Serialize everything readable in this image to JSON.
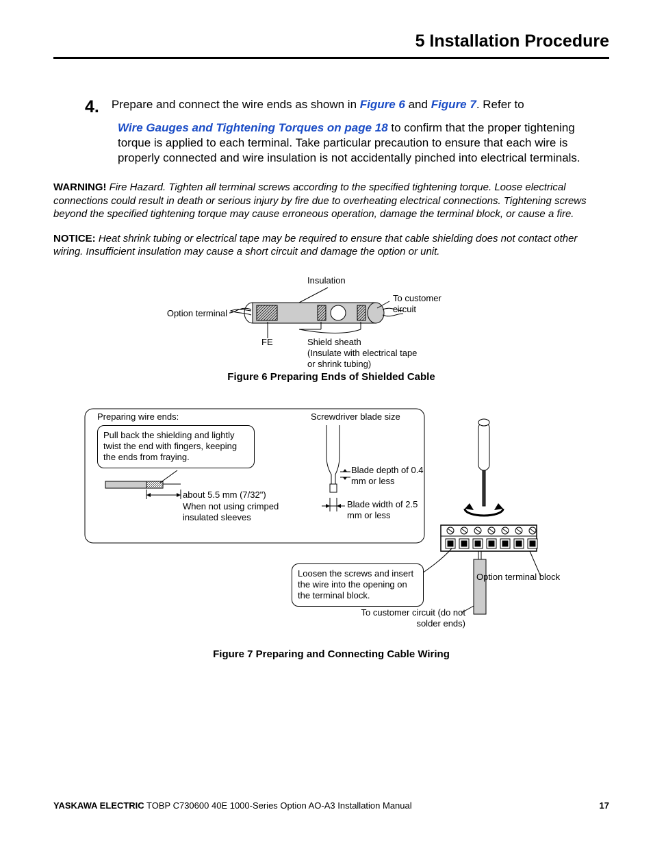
{
  "header": {
    "section": "5  Installation Procedure"
  },
  "step": {
    "number": "4.",
    "text_a": "Prepare and connect the wire ends as shown in ",
    "link_fig6": "Figure 6",
    "text_b": " and ",
    "link_fig7": "Figure 7",
    "text_c": ". Refer to ",
    "link_wire": "Wire Gauges and Tightening Torques on page 18",
    "text_d": " to confirm that the proper tightening torque is applied to each terminal. Take particular precaution to ensure that each wire is properly connected and wire insulation is not accidentally pinched into electrical terminals."
  },
  "warning": {
    "label": "WARNING!",
    "text": " Fire Hazard. Tighten all terminal screws according to the specified tightening torque. Loose electrical connections could result in death or serious injury by fire due to overheating electrical connections. Tightening screws beyond the specified tightening torque may cause erroneous operation, damage the terminal block, or cause a fire."
  },
  "notice": {
    "label": "NOTICE:",
    "text": " Heat shrink tubing or electrical tape may be required to ensure that cable shielding does not contact other wiring. Insufficient insulation may cause a short circuit and damage the option or unit."
  },
  "figure6": {
    "caption": "Figure 6  Preparing Ends of Shielded Cable",
    "labels": {
      "insulation": "Insulation",
      "option_terminal": "Option terminal",
      "to_customer": "To customer circuit",
      "fe": "FE",
      "shield_line1": "Shield sheath",
      "shield_line2": "(Insulate with electrical tape",
      "shield_line3": "or shrink tubing)"
    }
  },
  "figure7": {
    "caption": "Figure 7  Preparing and Connecting Cable Wiring",
    "labels": {
      "prep_heading": "Preparing wire ends:",
      "box1": "Pull back the shielding and lightly twist the end with fingers, keeping the ends from fraying.",
      "about": "about 5.5 mm (7/32\")",
      "when_not": "When not using crimped insulated sleeves",
      "screwdriver_heading": "Screwdriver blade size",
      "blade_depth": "Blade depth of 0.4 mm or less",
      "blade_width": "Blade width of 2.5 mm or less",
      "box2": "Loosen the screws and insert the wire into the opening on the terminal block.",
      "to_customer": "To customer circuit (do not solder ends)",
      "option_block": "Option terminal block"
    }
  },
  "footer": {
    "brand": "YASKAWA ELECTRIC",
    "doc": " TOBP C730600 40E 1000-Series Option AO-A3 Installation Manual",
    "page": "17"
  }
}
